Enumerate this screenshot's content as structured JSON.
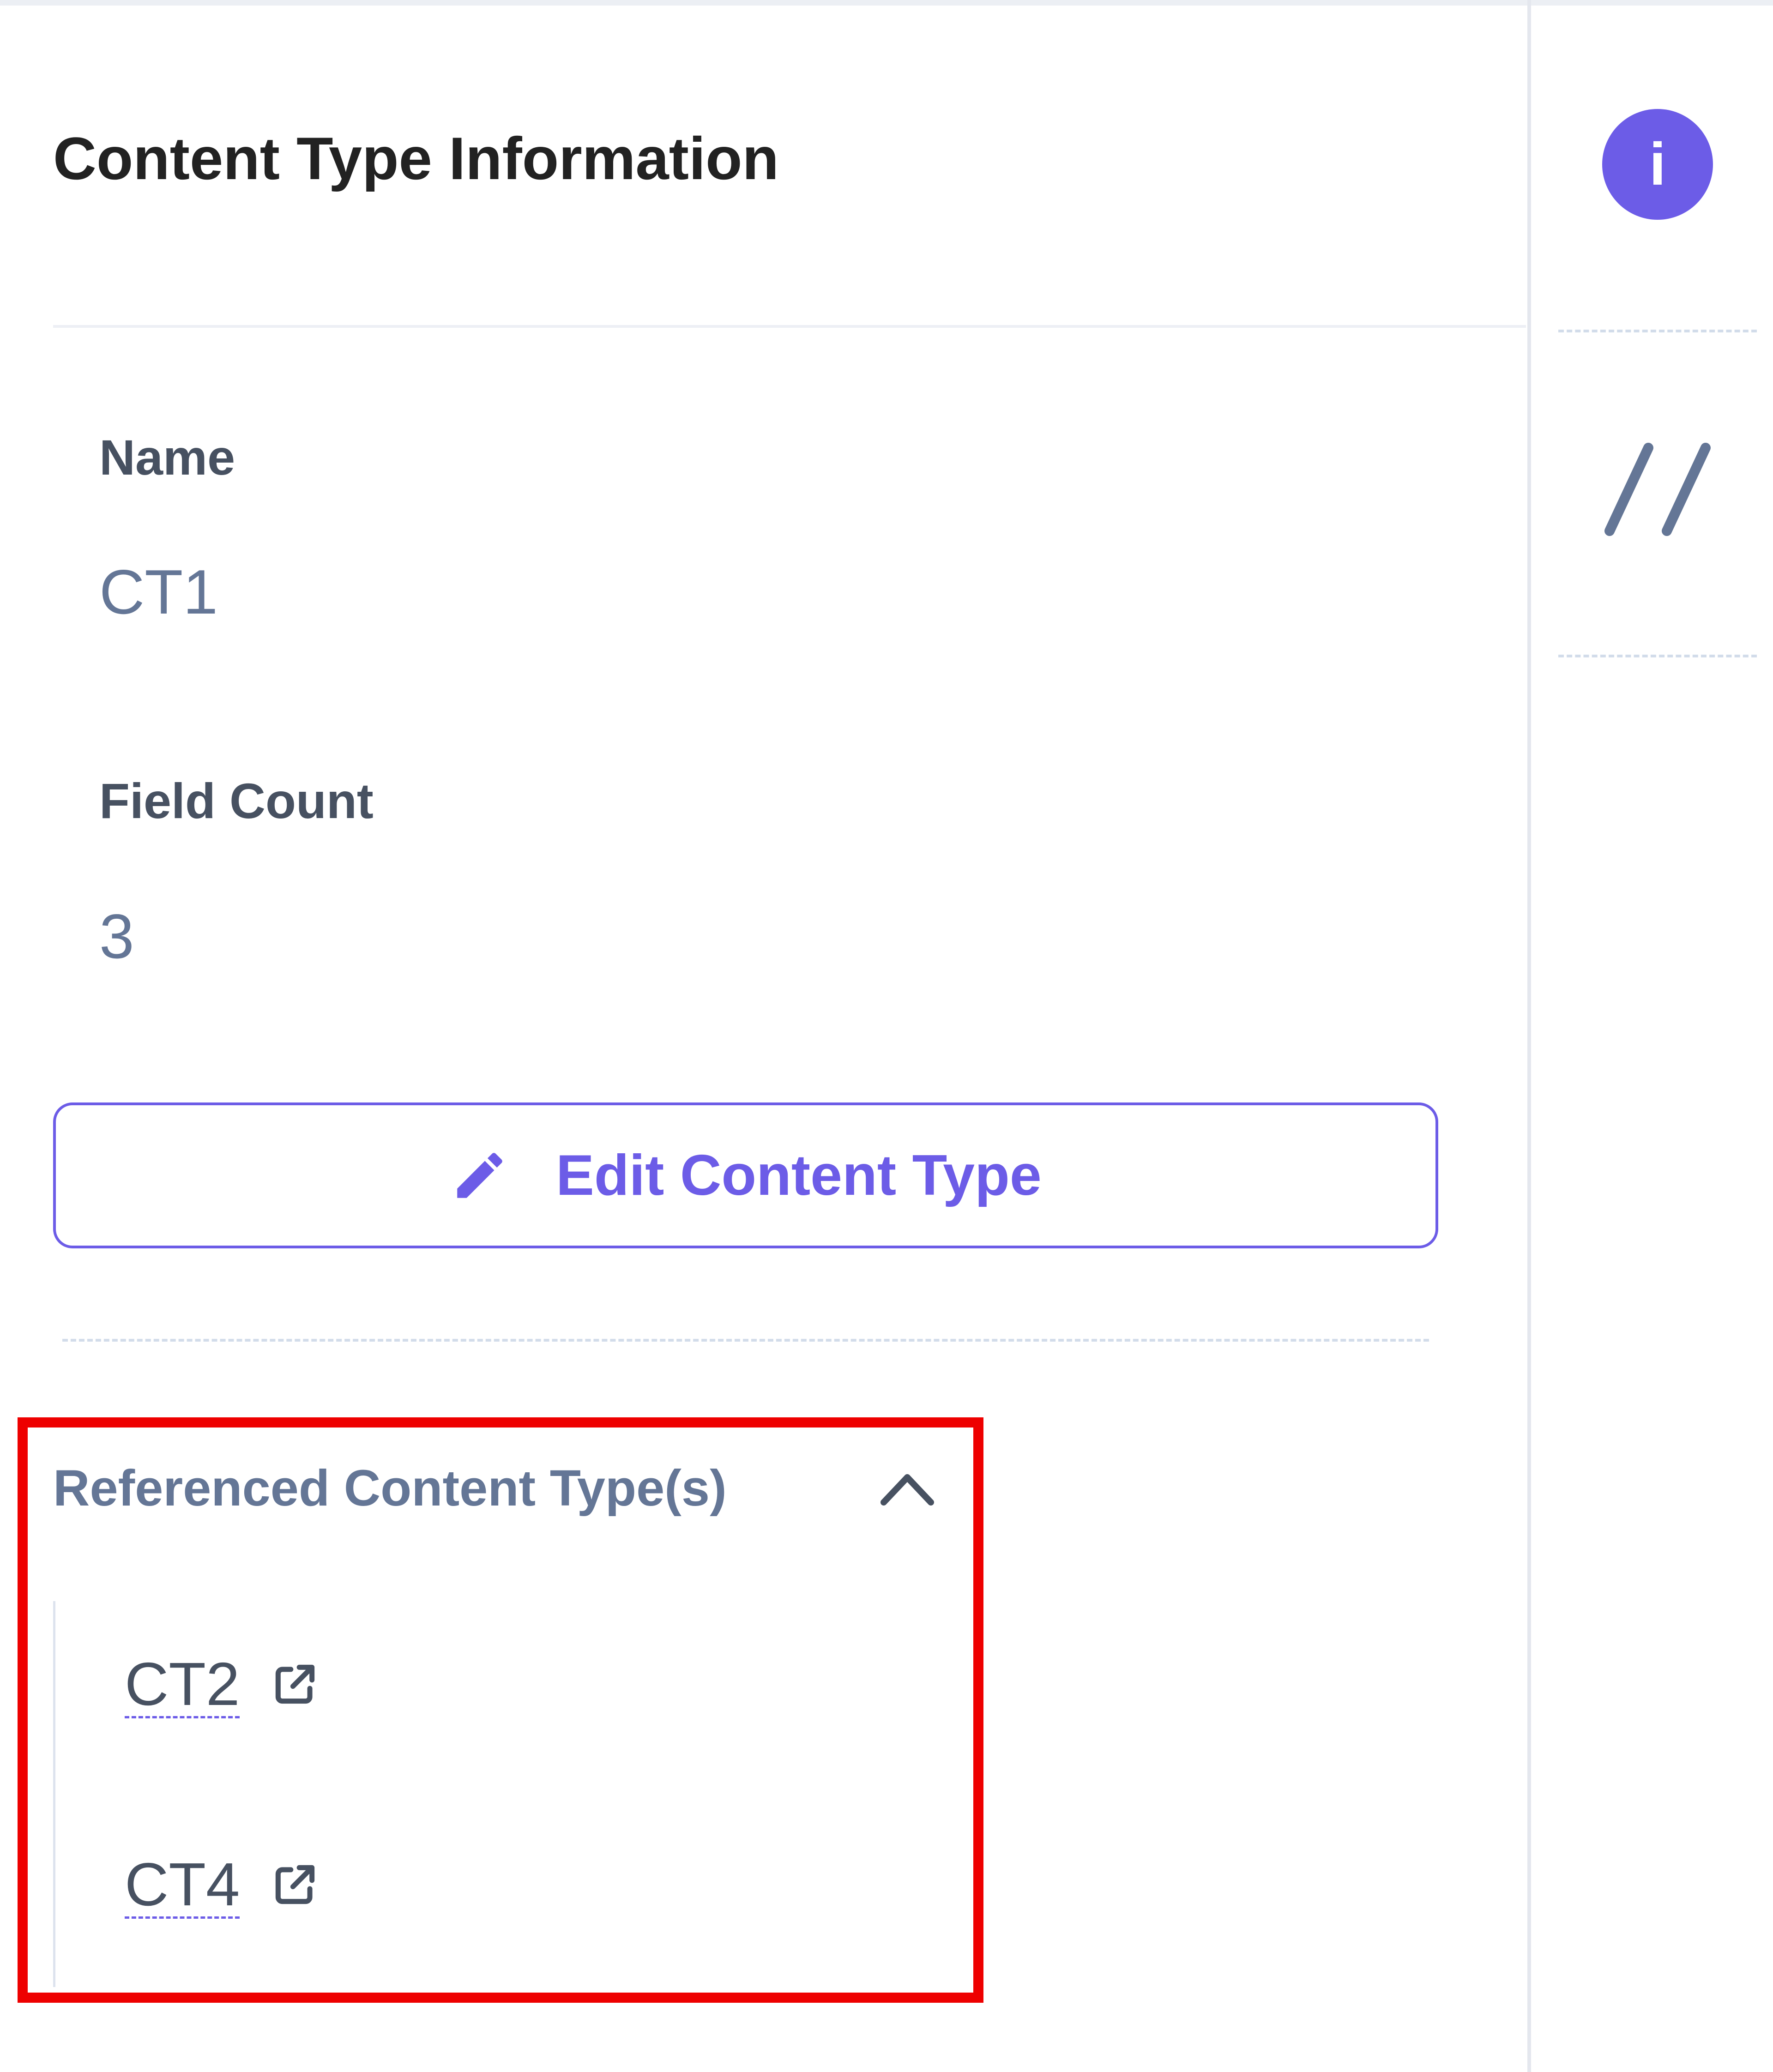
{
  "panel": {
    "title": "Content Type Information",
    "fields": [
      {
        "label": "Name",
        "value": "CT1"
      },
      {
        "label": "Field Count",
        "value": "3"
      }
    ],
    "edit_button": {
      "label": "Edit Content Type",
      "icon": "pencil-icon"
    }
  },
  "referenced": {
    "header": "Referenced Content Type(s)",
    "expanded": true,
    "toggle_icon": "chevron-up-icon",
    "items": [
      {
        "label": "CT2",
        "icon": "external-link-icon"
      },
      {
        "label": "CT4",
        "icon": "external-link-icon"
      }
    ]
  },
  "rail": {
    "info_icon": "info-icon",
    "info_glyph": "i",
    "json_icon": "slash-slash-icon"
  },
  "colors": {
    "accent": "#6c5ce7",
    "heading": "#222222",
    "label": "#475161",
    "value": "#647696",
    "highlight_border": "#ee0000"
  }
}
